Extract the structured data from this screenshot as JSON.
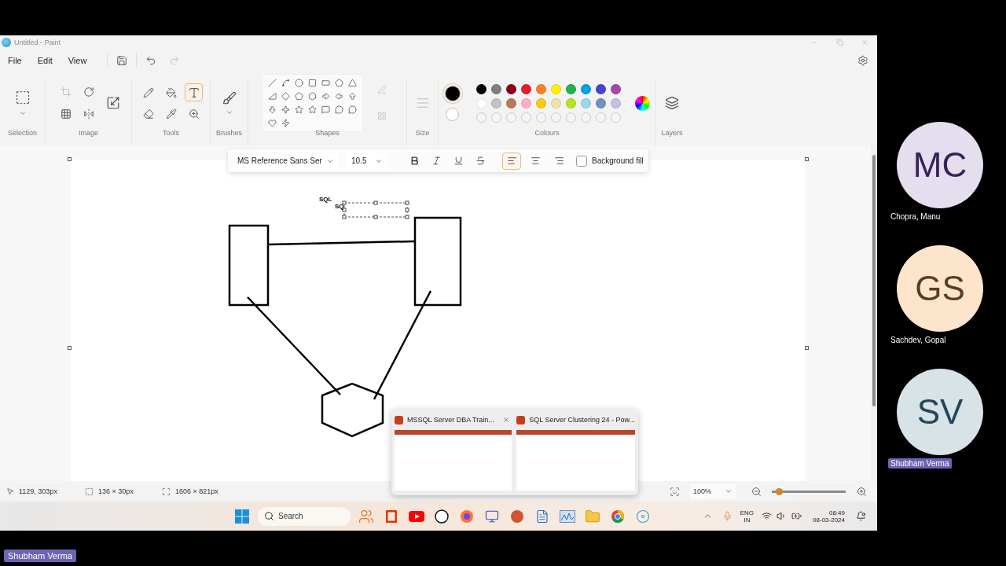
{
  "window": {
    "title": "Untitled - Paint"
  },
  "menu": [
    "File",
    "Edit",
    "View"
  ],
  "ribbon_groups": [
    "Selection",
    "Image",
    "Tools",
    "Brushes",
    "Shapes",
    "Size",
    "Colours",
    "Layers"
  ],
  "tools": [
    {
      "kind": "pencil",
      "selected": false
    },
    {
      "kind": "fill",
      "selected": false
    },
    {
      "kind": "text",
      "selected": true
    },
    {
      "kind": "eraser",
      "selected": false
    },
    {
      "kind": "picker",
      "selected": false
    },
    {
      "kind": "magnifier",
      "selected": false
    }
  ],
  "colours": {
    "primary": {
      "color": "#000000",
      "selected": true
    },
    "secondary": {
      "color": "#ffffff",
      "selected": false
    },
    "palette": [
      {
        "color": "#000000"
      },
      {
        "color": "#7f7f7f"
      },
      {
        "color": "#880015"
      },
      {
        "color": "#ed1c24"
      },
      {
        "color": "#ff7f27"
      },
      {
        "color": "#fff200"
      },
      {
        "color": "#22b14c"
      },
      {
        "color": "#00a2e8"
      },
      {
        "color": "#3f48cc"
      },
      {
        "color": "#a349a4"
      },
      {
        "color": "#ffffff"
      },
      {
        "color": "#c3c3c3"
      },
      {
        "color": "#b97a57"
      },
      {
        "color": "#ffaec9"
      },
      {
        "color": "#ffc90e"
      },
      {
        "color": "#efe4b0"
      },
      {
        "color": "#b5e61d"
      },
      {
        "color": "#99d9ea"
      },
      {
        "color": "#7092be"
      },
      {
        "color": "#c8bfe7"
      }
    ]
  },
  "text_toolbar": {
    "font": "MS Reference Sans Ser",
    "size": "10.5",
    "styles": [
      {
        "kind": "bold",
        "selected": false
      },
      {
        "kind": "italic",
        "selected": false
      },
      {
        "kind": "underline",
        "selected": false
      },
      {
        "kind": "strike",
        "selected": false
      }
    ],
    "alignment": [
      {
        "kind": "left",
        "selected": true
      },
      {
        "kind": "center",
        "selected": false
      },
      {
        "kind": "right",
        "selected": false
      }
    ],
    "background_fill": {
      "label": "Background fill",
      "checked": false
    }
  },
  "canvas": {
    "labels": [
      {
        "text": "SQL",
        "kind": "placed"
      },
      {
        "text": "SQ",
        "kind": "editing"
      }
    ]
  },
  "status_bar": {
    "cursor": "1129, 303px",
    "selection": "136 × 30px",
    "canvas_size": "1606 × 821px",
    "zoom": "100%",
    "zoom_slider": {
      "level": 0.1
    }
  },
  "thumbnails": [
    {
      "title": "MSSQL Server DBA Train...",
      "closable": true
    },
    {
      "title": "SQL Server Clustering  24 - Pow...",
      "closable": false
    }
  ],
  "taskbar": {
    "search": {
      "placeholder": "Search"
    },
    "language": [
      "ENG",
      "IN"
    ],
    "time": "08:49",
    "date": "08-03-2024"
  },
  "participants": [
    {
      "initials": "MC",
      "name": "Chopra, Manu",
      "color": "#e4deef",
      "highlighted": false
    },
    {
      "initials": "GS",
      "name": "Sachdev, Gopal",
      "color": "#fde5cc",
      "highlighted": false
    },
    {
      "initials": "SV",
      "name": "Shubham Verma",
      "color": "#d8e3e8",
      "highlighted": true
    }
  ],
  "presenter_label": "Shubham Verma"
}
